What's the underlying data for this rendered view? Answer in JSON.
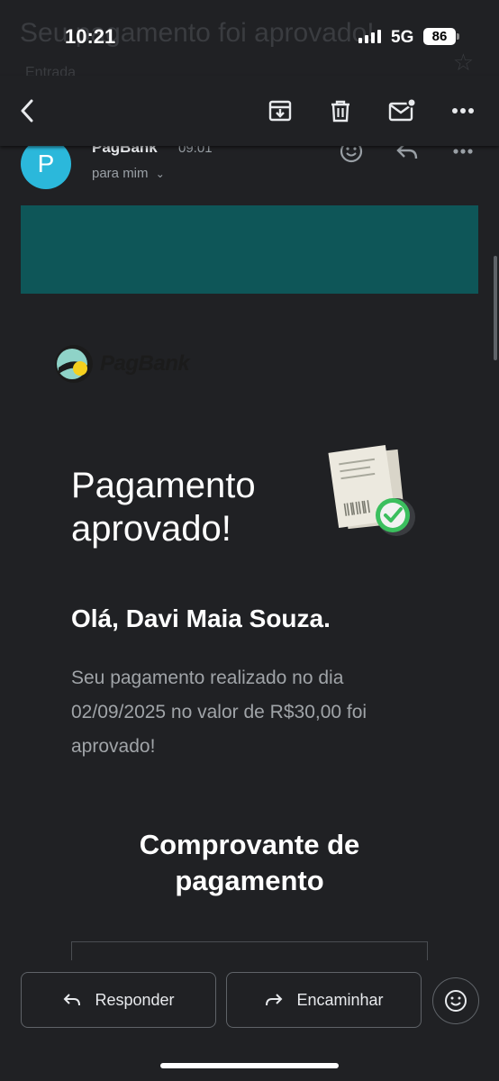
{
  "status_bar": {
    "time": "10:21",
    "network": "5G",
    "battery": "86"
  },
  "background": {
    "subject": "Seu pagamento foi aprovado!",
    "label": "Entrada"
  },
  "toolbar": {
    "back_icon": "back-arrow-icon",
    "archive_icon": "archive-icon",
    "delete_icon": "trash-icon",
    "unread_icon": "mark-unread-icon",
    "more_icon": "more-vert-icon"
  },
  "sender": {
    "initial": "P",
    "name": "PagBank",
    "time": "09:01",
    "recipient": "para mim"
  },
  "email": {
    "banner_color": "#0e5658",
    "logo_text": "PagBank",
    "headline": "Pagamento aprovado!",
    "greeting": "Olá, Davi Maia Souza.",
    "body": "Seu pagamento realizado no dia 02/09/2025 no valor de R$30,00 foi aprovado!",
    "receipt_title": "Comprovante de pagamento"
  },
  "actions": {
    "reply": "Responder",
    "forward": "Encaminhar"
  }
}
